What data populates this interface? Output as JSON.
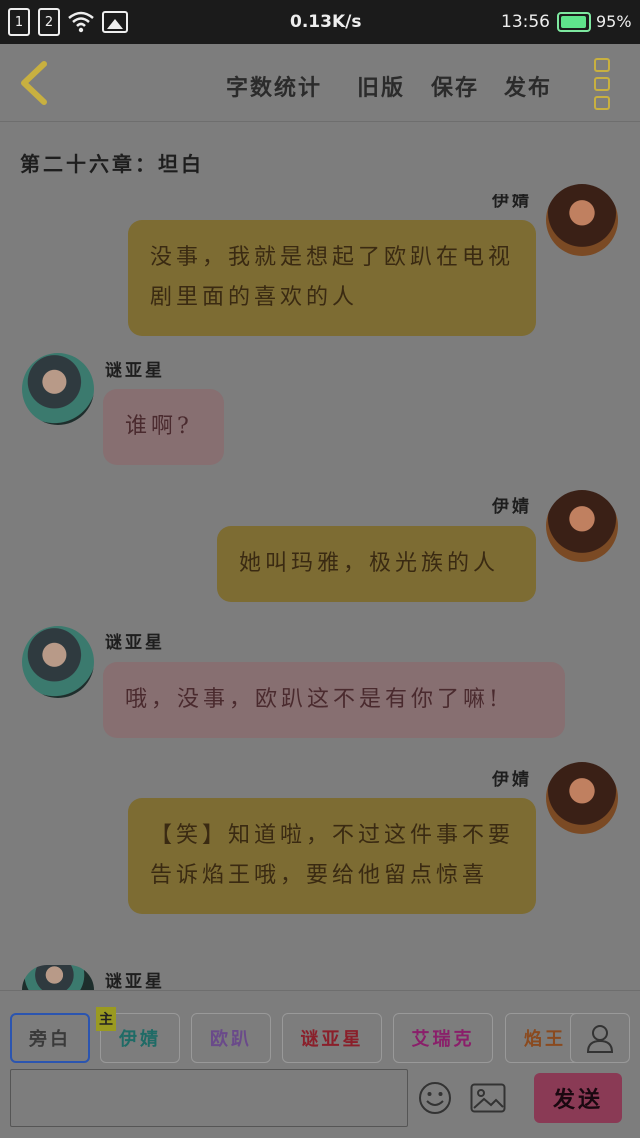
{
  "status_bar": {
    "sim1": "1",
    "sim2": "2",
    "net_speed": "0.13K/s",
    "time": "13:56",
    "battery_percent": "95%",
    "battery_level": 0.95,
    "battery_color": "#5fe38b"
  },
  "top_bar": {
    "word_count_label": "字数统计",
    "old_version_label": "旧版",
    "save_label": "保存",
    "publish_label": "发布"
  },
  "chapter": {
    "title": "第二十六章：坦白"
  },
  "messages": [
    {
      "speaker": "伊婧",
      "side": "right",
      "text": "没事，我就是想起了欧趴在电视剧里面的喜欢的人"
    },
    {
      "speaker": "谜亚星",
      "side": "left",
      "text": "谁啊?"
    },
    {
      "speaker": "伊婧",
      "side": "right",
      "text": "她叫玛雅，极光族的人"
    },
    {
      "speaker": "谜亚星",
      "side": "left",
      "text": "哦，没事，欧趴这不是有你了嘛!"
    },
    {
      "speaker": "伊婧",
      "side": "right",
      "text": "【笑】知道啦，不过这件事不要告诉焰王哦，要给他留点惊喜"
    },
    {
      "speaker": "谜亚星",
      "side": "left",
      "text": ""
    }
  ],
  "roles": [
    {
      "label": "旁白",
      "color": "#3a3a3a",
      "selected": true
    },
    {
      "label": "伊婧",
      "color": "#1f6b66",
      "host": true
    },
    {
      "label": "欧趴",
      "color": "#6a4a8a"
    },
    {
      "label": "谜亚星",
      "color": "#8a1f2a"
    },
    {
      "label": "艾瑞克",
      "color": "#8a1f6a"
    },
    {
      "label": "焰王",
      "color": "#8a4a1f"
    }
  ],
  "host_badge": "主",
  "composer": {
    "input_value": "",
    "send_label": "发送"
  },
  "colors": {
    "accent_yellow": "#c8b040",
    "right_bubble": "#7d6c33",
    "left_bubble": "#876f71",
    "send_button": "#8a3a55"
  }
}
